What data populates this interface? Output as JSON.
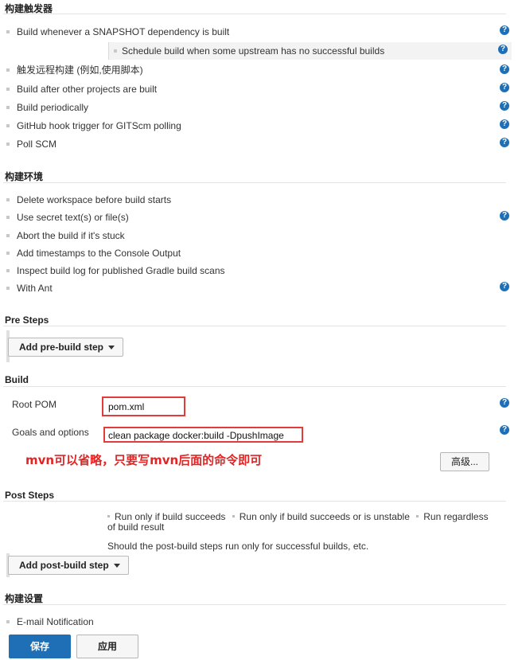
{
  "triggers": {
    "title": "构建触发器",
    "items": [
      {
        "label": "Build whenever a SNAPSHOT dependency is built",
        "help": true
      },
      {
        "label": "触发远程构建 (例如,使用脚本)",
        "help": true
      },
      {
        "label": "Build after other projects are built",
        "help": true
      },
      {
        "label": "Build periodically",
        "help": true
      },
      {
        "label": "GitHub hook trigger for GITScm polling",
        "help": true
      },
      {
        "label": "Poll SCM",
        "help": true
      }
    ],
    "sub_item": {
      "label": "Schedule build when some upstream has no successful builds"
    }
  },
  "environment": {
    "title": "构建环境",
    "items": [
      {
        "label": "Delete workspace before build starts"
      },
      {
        "label": "Use secret text(s) or file(s)"
      },
      {
        "label": "Abort the build if it's stuck"
      },
      {
        "label": "Add timestamps to the Console Output"
      },
      {
        "label": "Inspect build log for published Gradle build scans"
      },
      {
        "label": "With Ant"
      }
    ]
  },
  "pre_steps": {
    "title": "Pre Steps",
    "button": "Add pre-build step"
  },
  "build": {
    "title": "Build",
    "root_pom_label": "Root POM",
    "root_pom_value": "pom.xml",
    "goals_label": "Goals and options",
    "goals_value": "clean package docker:build -DpushImage",
    "annotation": "mvn可以省略，只要写mvn后面的命令即可",
    "advanced_button": "高级..."
  },
  "post_steps": {
    "title": "Post Steps",
    "options": [
      "Run only if build succeeds",
      "Run only if build succeeds or is unstable",
      "Run regardless of build result"
    ],
    "description": "Should the post-build steps run only for successful builds, etc.",
    "button": "Add post-build step"
  },
  "settings": {
    "title": "构建设置",
    "email": "E-mail Notification"
  },
  "footer": {
    "save": "保存",
    "apply": "应用"
  },
  "help_glyph": "?"
}
